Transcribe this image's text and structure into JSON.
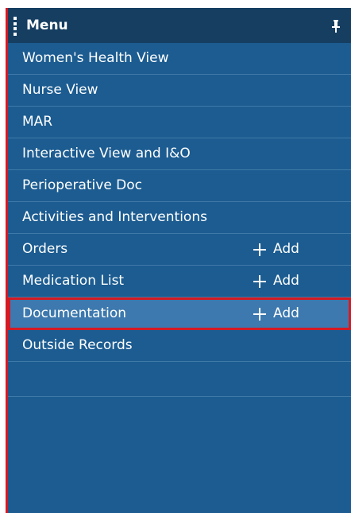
{
  "header": {
    "title": "Menu",
    "pin_icon": "pin-icon",
    "grip_icon": "drag-grip-icon"
  },
  "colors": {
    "accent": "#d41a23",
    "panel": "#1c5c91",
    "header": "#153e61",
    "selected": "#3d79ae"
  },
  "menu": {
    "items": [
      {
        "label": "Women's Health View"
      },
      {
        "label": "Nurse View"
      },
      {
        "label": "MAR"
      },
      {
        "label": "Interactive View and I&O"
      },
      {
        "label": "Perioperative Doc"
      },
      {
        "label": "Activities and Interventions"
      },
      {
        "label": "Orders",
        "add_label": "Add"
      },
      {
        "label": "Medication List",
        "add_label": "Add"
      },
      {
        "label": "Documentation",
        "add_label": "Add",
        "selected": true
      },
      {
        "label": "Outside Records"
      }
    ]
  }
}
